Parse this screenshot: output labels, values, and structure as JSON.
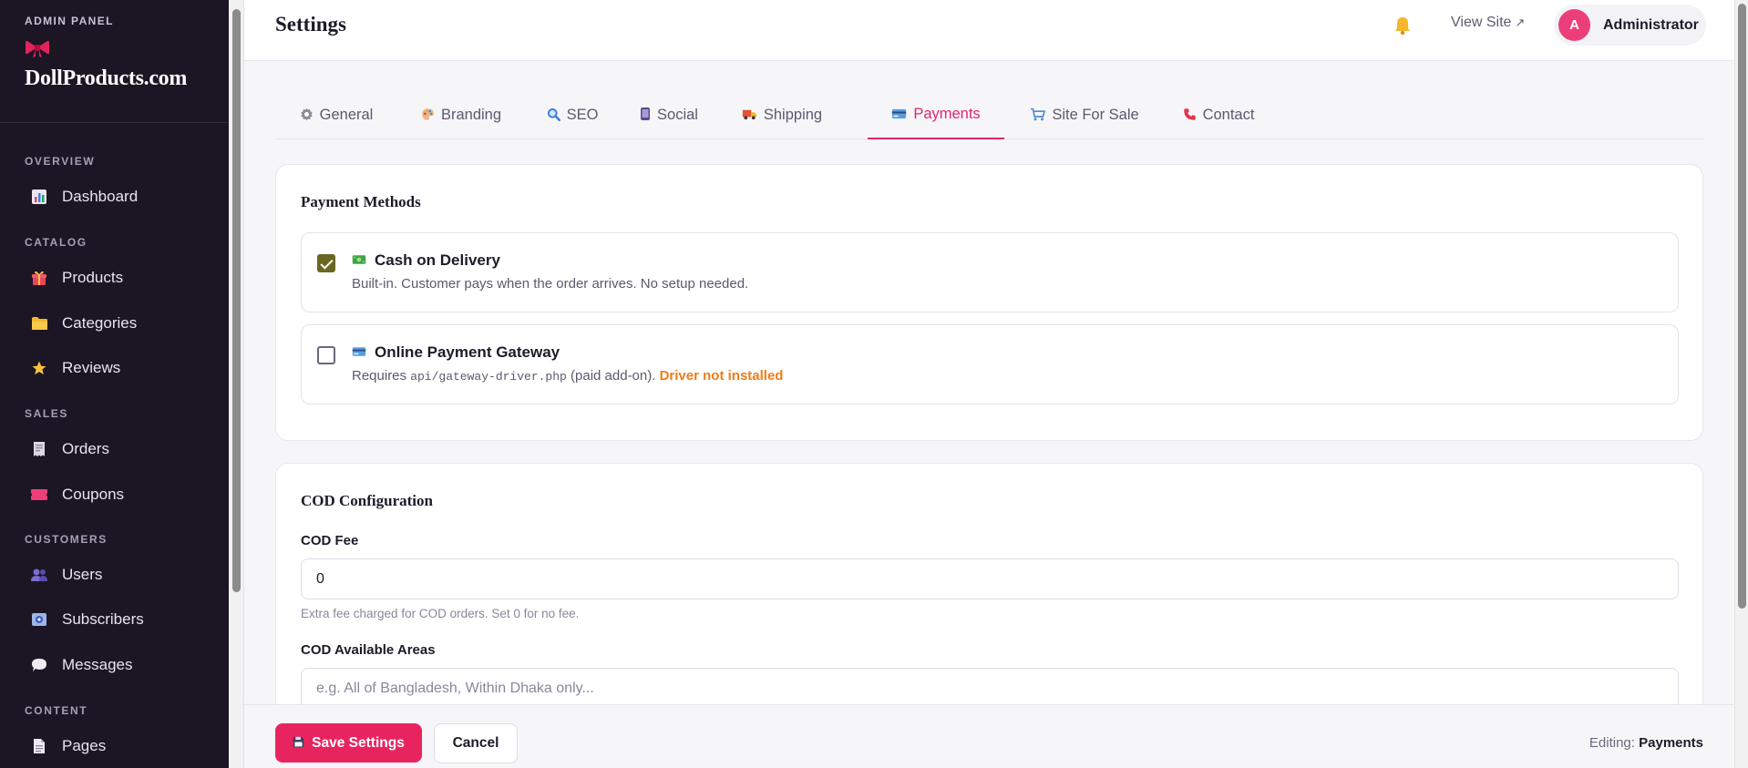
{
  "sidebar": {
    "eyebrow": "ADMIN PANEL",
    "brand_name": "DollProducts.com",
    "sections": {
      "overview": "OVERVIEW",
      "catalog": "CATALOG",
      "sales": "SALES",
      "customers": "CUSTOMERS",
      "content": "CONTENT"
    },
    "items": {
      "dashboard": "Dashboard",
      "products": "Products",
      "categories": "Categories",
      "reviews": "Reviews",
      "orders": "Orders",
      "coupons": "Coupons",
      "users": "Users",
      "subscribers": "Subscribers",
      "messages": "Messages",
      "pages": "Pages"
    }
  },
  "header": {
    "title": "Settings",
    "view_site": "View Site",
    "view_site_arrow": "↗",
    "avatar_initial": "A",
    "user_name": "Administrator"
  },
  "tabs": {
    "general": "General",
    "branding": "Branding",
    "seo": "SEO",
    "social": "Social",
    "shipping": "Shipping",
    "payments": "Payments",
    "site_for_sale": "Site For Sale",
    "contact": "Contact",
    "active": "payments"
  },
  "payment_methods": {
    "title": "Payment Methods",
    "cod": {
      "checked": true,
      "title": "Cash on Delivery",
      "description": "Built-in. Customer pays when the order arrives. No setup needed."
    },
    "gateway": {
      "checked": false,
      "title": "Online Payment Gateway",
      "desc_prefix": "Requires",
      "desc_code": "api/gateway-driver.php",
      "desc_suffix": "(paid add-on).",
      "status": "Driver not installed"
    }
  },
  "cod_config": {
    "title": "COD Configuration",
    "fee_label": "COD Fee",
    "fee_value": "0",
    "fee_help": "Extra fee charged for COD orders. Set 0 for no fee.",
    "areas_label": "COD Available Areas",
    "areas_placeholder": "e.g. All of Bangladesh, Within Dhaka only..."
  },
  "footer": {
    "save": "Save Settings",
    "cancel": "Cancel",
    "editing_label": "Editing:",
    "editing_value": "Payments"
  },
  "colors": {
    "accent": "#e32570",
    "sidebar_bg": "#1c1524",
    "warning": "#f07c18"
  }
}
